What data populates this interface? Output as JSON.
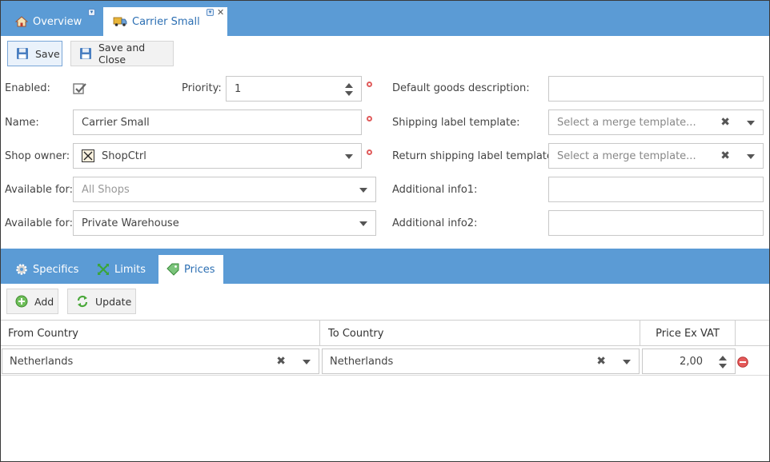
{
  "tabs": {
    "overview": "Overview",
    "active": "Carrier Small"
  },
  "toolbar": {
    "save": "Save",
    "save_close": "Save and Close"
  },
  "form": {
    "enabled_label": "Enabled:",
    "enabled_checked": true,
    "priority_label": "Priority:",
    "priority_value": "1",
    "name_label": "Name:",
    "name_value": "Carrier Small",
    "shop_owner_label": "Shop owner:",
    "shop_owner_value": "ShopCtrl",
    "available_for_label_1": "Available for:",
    "available_for_value_1": "All Shops",
    "available_for_label_2": "Available for:",
    "available_for_value_2": "Private Warehouse",
    "default_goods_label": "Default goods description:",
    "default_goods_value": "",
    "shipping_label_label": "Shipping label template:",
    "shipping_label_placeholder": "Select a merge template...",
    "return_label_label": "Return shipping label template:",
    "return_label_placeholder": "Select a merge template...",
    "additional1_label": "Additional info1:",
    "additional1_value": "",
    "additional2_label": "Additional info2:",
    "additional2_value": ""
  },
  "section_tabs": {
    "specifics": "Specifics",
    "limits": "Limits",
    "prices": "Prices"
  },
  "grid_toolbar": {
    "add": "Add",
    "update": "Update"
  },
  "grid": {
    "columns": [
      "From Country",
      "To Country",
      "Price Ex VAT"
    ],
    "rows": [
      {
        "from": "Netherlands",
        "to": "Netherlands",
        "price": "2,00"
      }
    ]
  },
  "colors": {
    "bar": "#5b9bd5",
    "active_tab_text": "#2c6fb3",
    "required": "#e05b5b",
    "remove": "#e05555"
  }
}
